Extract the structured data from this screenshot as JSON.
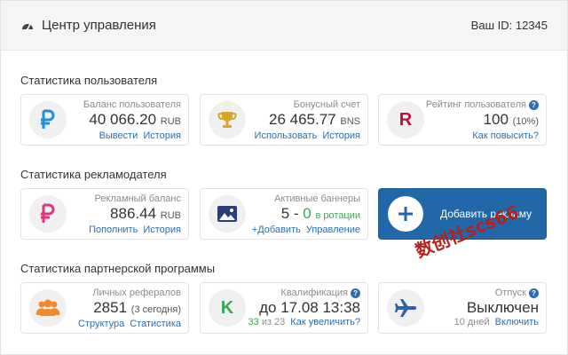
{
  "header": {
    "title": "Центр управления",
    "user_id": "Ваш ID: 12345"
  },
  "sections": {
    "user": "Статистика пользователя",
    "advertiser": "Статистика рекламодателя",
    "partner": "Статистика партнерской программы"
  },
  "cards": {
    "balance": {
      "label": "Баланс пользователя",
      "value": "40 066.20",
      "unit": "RUB",
      "link1": "Вывести",
      "link2": "История"
    },
    "bonus": {
      "label": "Бонусный счет",
      "value": "26 465.77",
      "unit": "BNS",
      "link1": "Использовать",
      "link2": "История"
    },
    "rating": {
      "label": "Рейтинг пользователя",
      "value": "100",
      "unit": "(10%)",
      "link1": "Как повысить?",
      "letter": "R"
    },
    "ad_balance": {
      "label": "Рекламный баланс",
      "value": "886.44",
      "unit": "RUB",
      "link1": "Пополнить",
      "link2": "История"
    },
    "banners": {
      "label": "Активные баннеры",
      "value": "5 -",
      "value_zero": "0",
      "unit": "в ротации",
      "link1": "+Добавить",
      "link2": "Управление"
    },
    "referrals": {
      "label": "Личных рефералов",
      "value": "2851",
      "unit": "(3 сегодня)",
      "link1": "Структура",
      "link2": "Статистика"
    },
    "qualification": {
      "label": "Квалификация",
      "value": "до 17.08 13:38",
      "progress_current": "33",
      "progress_sep": "из 23",
      "link1": "Как увеличить?",
      "letter": "K"
    },
    "vacation": {
      "label": "Отпуск",
      "value": "Выключен",
      "note": "10 дней",
      "link1": "Включить"
    }
  },
  "add_ad_button": {
    "label": "Добавить рекламу"
  },
  "watermark": "数创社scs66",
  "colors": {
    "accent_blue": "#2268a8",
    "ruble_blue": "#1e90d6",
    "ruble_pink": "#e0357a",
    "trophy_gold": "#d9a52b",
    "rating_red": "#b5113f",
    "green": "#3aa655",
    "orange": "#f08a2c",
    "plane_blue": "#2f63a8"
  },
  "icons": [
    "gauge-icon",
    "ruble-icon",
    "trophy-icon",
    "image-icon",
    "users-icon",
    "plane-icon",
    "plus-icon",
    "question-icon"
  ]
}
